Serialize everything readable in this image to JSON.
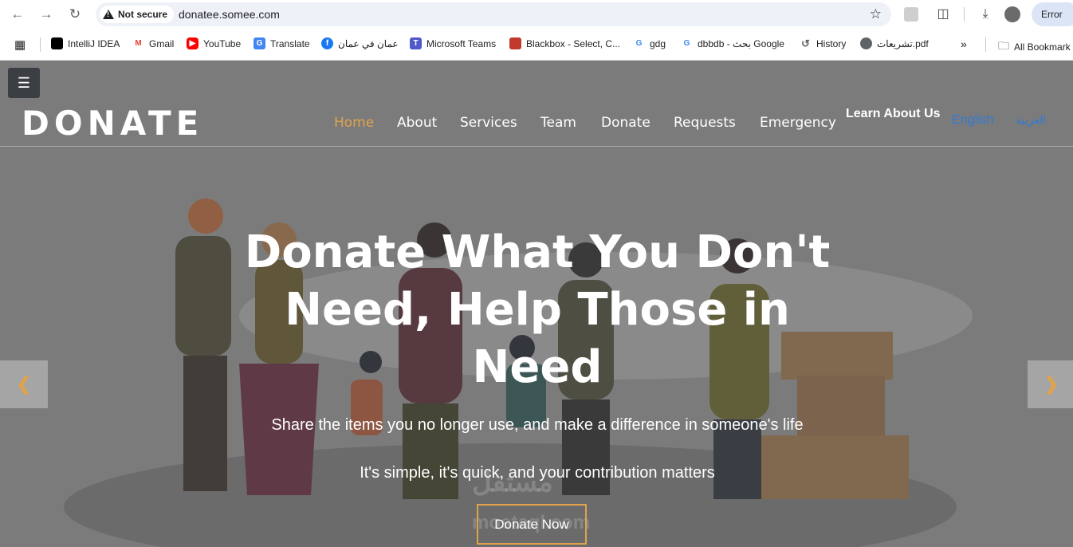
{
  "browser": {
    "security_label": "Not secure",
    "url": "donatee.somee.com",
    "error_label": "Error"
  },
  "bookmarks": [
    {
      "label": "IntelliJ IDEA",
      "color": "#000000"
    },
    {
      "label": "Gmail",
      "color": "#ea4335"
    },
    {
      "label": "YouTube",
      "color": "#ff0000"
    },
    {
      "label": "Translate",
      "color": "#4285f4"
    },
    {
      "label": "عمان في عمان",
      "color": "#1877f2"
    },
    {
      "label": "Microsoft Teams",
      "color": "#5059c9"
    },
    {
      "label": "Blackbox - Select, C...",
      "color": "#333333"
    },
    {
      "label": "gdg",
      "color": "#4285f4"
    },
    {
      "label": "dbbdb - بحث Google",
      "color": "#4285f4"
    },
    {
      "label": "History",
      "color": "#5f6368"
    },
    {
      "label": "تشريعات.pdf",
      "color": "#5f6368"
    }
  ],
  "bookmarks_overflow": "»",
  "all_bookmarks": "All Bookmark",
  "site": {
    "brand": "DONATE",
    "menu_icon": "hamburger-icon",
    "nav": [
      "Home",
      "About",
      "Services",
      "Team",
      "Donate",
      "Requests",
      "Emergency"
    ],
    "active_nav": "Home",
    "learn_about": "Learn About Us",
    "lang_english": "English",
    "lang_arabic": "العربية",
    "accent_color": "#e0a34b"
  },
  "hero": {
    "title": "Donate What You Don't Need, Help Those in Need",
    "subtitle": "Share the items you no longer use, and make a difference in someone's life",
    "subtitle2": "It's simple, it's quick, and your contribution matters",
    "cta": "Donate Now",
    "prev_icon": "chevron-left-icon",
    "next_icon": "chevron-right-icon"
  },
  "watermark": {
    "arabic": "مستقل",
    "latin": "mostaql.com"
  }
}
